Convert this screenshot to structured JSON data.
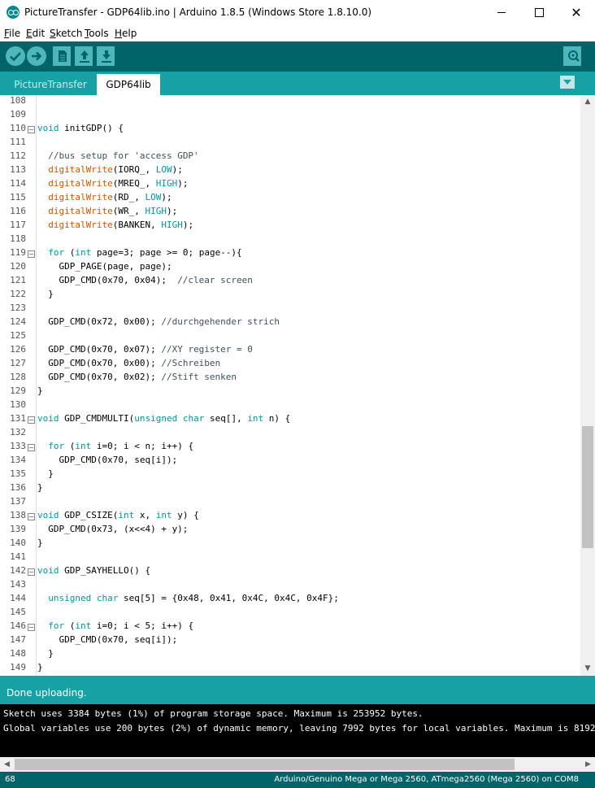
{
  "window": {
    "title": "PictureTransfer - GDP64lib.ino | Arduino 1.8.5 (Windows Store 1.8.10.0)",
    "close_glyph": "✕"
  },
  "menu": [
    {
      "label": "File",
      "key": "F",
      "rest": "ile"
    },
    {
      "label": "Edit",
      "key": "E",
      "rest": "dit"
    },
    {
      "label": "Sketch",
      "key": "S",
      "rest": "ketch"
    },
    {
      "label": "Tools",
      "key": "T",
      "rest": "ools"
    },
    {
      "label": "Help",
      "key": "H",
      "rest": "elp"
    }
  ],
  "toolbar": {
    "buttons": [
      "verify-icon",
      "upload-icon",
      "new-icon",
      "open-icon",
      "save-icon"
    ],
    "serial_monitor": "serial-monitor-icon"
  },
  "tabs": [
    {
      "label": "PictureTransfer",
      "active": false
    },
    {
      "label": "GDP64lib",
      "active": true
    }
  ],
  "editor": {
    "lines": [
      {
        "n": "108",
        "code": ""
      },
      {
        "n": "109",
        "code": ""
      },
      {
        "n": "110",
        "code": "void initGDP() {"
      },
      {
        "n": "111",
        "code": ""
      },
      {
        "n": "112",
        "code": "  //bus setup for 'access GDP'"
      },
      {
        "n": "113",
        "code": "  digitalWrite(IORQ_, LOW);"
      },
      {
        "n": "114",
        "code": "  digitalWrite(MREQ_, HIGH);"
      },
      {
        "n": "115",
        "code": "  digitalWrite(RD_, LOW);"
      },
      {
        "n": "116",
        "code": "  digitalWrite(WR_, HIGH);"
      },
      {
        "n": "117",
        "code": "  digitalWrite(BANKEN, HIGH);"
      },
      {
        "n": "118",
        "code": ""
      },
      {
        "n": "119",
        "code": "  for (int page=3; page >= 0; page--){"
      },
      {
        "n": "120",
        "code": "    GDP_PAGE(page, page);"
      },
      {
        "n": "121",
        "code": "    GDP_CMD(0x70, 0x04);  //clear screen"
      },
      {
        "n": "122",
        "code": "  }"
      },
      {
        "n": "123",
        "code": ""
      },
      {
        "n": "124",
        "code": "  GDP_CMD(0x72, 0x00); //durchgehender strich"
      },
      {
        "n": "125",
        "code": ""
      },
      {
        "n": "126",
        "code": "  GDP_CMD(0x70, 0x07); //XY register = 0"
      },
      {
        "n": "127",
        "code": "  GDP_CMD(0x70, 0x00); //Schreiben"
      },
      {
        "n": "128",
        "code": "  GDP_CMD(0x70, 0x02); //Stift senken"
      },
      {
        "n": "129",
        "code": "}"
      },
      {
        "n": "130",
        "code": ""
      },
      {
        "n": "131",
        "code": "void GDP_CMDMULTI(unsigned char seq[], int n) {"
      },
      {
        "n": "132",
        "code": ""
      },
      {
        "n": "133",
        "code": "  for (int i=0; i < n; i++) {"
      },
      {
        "n": "134",
        "code": "    GDP_CMD(0x70, seq[i]);"
      },
      {
        "n": "135",
        "code": "  }"
      },
      {
        "n": "136",
        "code": "}"
      },
      {
        "n": "137",
        "code": ""
      },
      {
        "n": "138",
        "code": "void GDP_CSIZE(int x, int y) {"
      },
      {
        "n": "139",
        "code": "  GDP_CMD(0x73, (x<<4) + y);"
      },
      {
        "n": "140",
        "code": "}"
      },
      {
        "n": "141",
        "code": ""
      },
      {
        "n": "142",
        "code": "void GDP_SAYHELLO() {"
      },
      {
        "n": "143",
        "code": ""
      },
      {
        "n": "144",
        "code": "  unsigned char seq[5] = {0x48, 0x41, 0x4C, 0x4C, 0x4F};"
      },
      {
        "n": "145",
        "code": ""
      },
      {
        "n": "146",
        "code": "  for (int i=0; i < 5; i++) {"
      },
      {
        "n": "147",
        "code": "    GDP_CMD(0x70, seq[i]);"
      },
      {
        "n": "148",
        "code": "  }"
      },
      {
        "n": "149",
        "code": "}"
      }
    ],
    "fold_lines": [
      "110",
      "119",
      "131",
      "133",
      "138",
      "142",
      "146"
    ],
    "keywords": [
      "void",
      "for",
      "int",
      "unsigned",
      "char"
    ],
    "functions": [
      "digitalWrite"
    ],
    "constants": [
      "LOW",
      "HIGH"
    ]
  },
  "status": {
    "message": "Done uploading."
  },
  "console": {
    "lines": [
      "Sketch uses 3384 bytes (1%) of program storage space. Maximum is 253952 bytes.",
      "Global variables use 200 bytes (2%) of dynamic memory, leaving 7992 bytes for local variables. Maximum is 8192 bytes."
    ]
  },
  "footer": {
    "line_number": "68",
    "board": "Arduino/Genuino Mega or Mega 2560, ATmega2560 (Mega 2560) on COM8"
  },
  "colors": {
    "toolbar": "#006468",
    "tabs_bar": "#17a1a5",
    "keyword": "#00979c",
    "function": "#d35400",
    "comment": "#434f54"
  }
}
